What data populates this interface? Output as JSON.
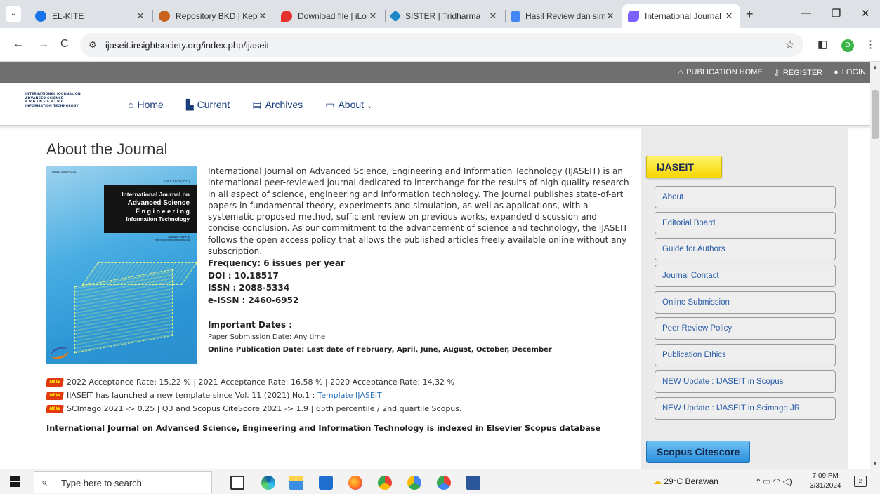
{
  "browser": {
    "tabs": [
      {
        "label": "EL-KITE",
        "color": "#1a73e8"
      },
      {
        "label": "Repository BKD | Kep",
        "color": "#c8641e"
      },
      {
        "label": "Download file | iLovel",
        "color": "#e5322d"
      },
      {
        "label": "SISTER | Tridharma",
        "color": "#1e88c8"
      },
      {
        "label": "Hasil Review dan sim",
        "color": "#4285f4"
      },
      {
        "label": "International Journal",
        "color": "#7b61ff"
      }
    ],
    "url": "ijaseit.insightsociety.org/index.php/ijaseit",
    "profile_initial": "D"
  },
  "site": {
    "top_links": [
      {
        "icon": "institution-icon",
        "label": "PUBLICATION HOME"
      },
      {
        "icon": "key-icon",
        "label": "REGISTER"
      },
      {
        "icon": "user-icon",
        "label": "LOGIN"
      }
    ],
    "logo_lines": [
      "INTERNATIONAL JOURNAL ON",
      "ADVANCED SCIENCE",
      "E N G I N E E R I N G",
      "INFORMATION TECHNOLOGY"
    ],
    "nav": [
      {
        "icon": "home-icon",
        "label": "Home"
      },
      {
        "icon": "file-icon",
        "label": "Current"
      },
      {
        "icon": "archive-icon",
        "label": "Archives"
      },
      {
        "icon": "monitor-icon",
        "label": "About"
      }
    ]
  },
  "main": {
    "title": "About the Journal",
    "cover": {
      "issn": "ISSN: 2088-5334",
      "vol": "Vol 1, No 2 (2011)",
      "title_lines": [
        "International Journal on",
        "Advanced Science",
        "E n g i n e e r i n g",
        "Information Technology"
      ],
      "available": "Available online at http://ijaseit.insightsociety.org"
    },
    "intro": "International Journal on Advanced Science, Engineering and Information Technology (IJASEIT) is an international peer-reviewed journal dedicated to interchange for the results of high quality research in all aspect of science, engineering and information technology. The journal publishes state-of-art papers in fundamental theory, experiments and simulation, as well as applications, with a systematic proposed method, sufficient review on previous works, expanded discussion and concise conclusion. As our commitment to the advancement of science and technology, the IJASEIT follows the open access policy that allows the published articles freely available online without any subscription.",
    "facts": [
      "Frequency: 6 issues per year",
      "DOI : 10.18517",
      "ISSN : 2088-5334",
      "e-ISSN : 2460-6952"
    ],
    "important_dates_title": "Important Dates :",
    "paper_submission": "Paper Submission Date: Any time",
    "online_publication": "Online Publication Date: Last date of February, April, June, August, October, December",
    "new_badge": "NEW",
    "news": [
      {
        "text": "2022 Acceptance Rate: 15.22 % | 2021 Acceptance Rate: 16.58 % | 2020 Acceptance Rate: 14.32 %",
        "link": ""
      },
      {
        "text": "IJASEIT has launched a new template since Vol. 11 (2021) No.1 :",
        "link": "Template IJASEIT"
      },
      {
        "text": "SCImago 2021 -> 0.25 | Q3 and Scopus CiteScore 2021 -> 1.9 | 65th percentile / 2nd quartile Scopus.",
        "link": ""
      }
    ],
    "indexed": "International Journal on Advanced Science, Engineering and Information Technology is indexed in Elsevier Scopus database"
  },
  "sidebar": {
    "header": "IJASEIT",
    "links": [
      "About",
      "Editorial Board",
      "Guide for Authors",
      "Journal Contact",
      "Online Submission",
      "Peer Review Policy",
      "Publication Ethics",
      "NEW Update : IJASEIT in Scopus",
      "NEW Update : IJASEIT in Scimago JR"
    ],
    "citescore": "Scopus Citescore"
  },
  "taskbar": {
    "search_placeholder": "Type here to search",
    "weather": "29°C  Berawan",
    "time": "7:09 PM",
    "date": "3/31/2024",
    "notif_count": "2"
  }
}
